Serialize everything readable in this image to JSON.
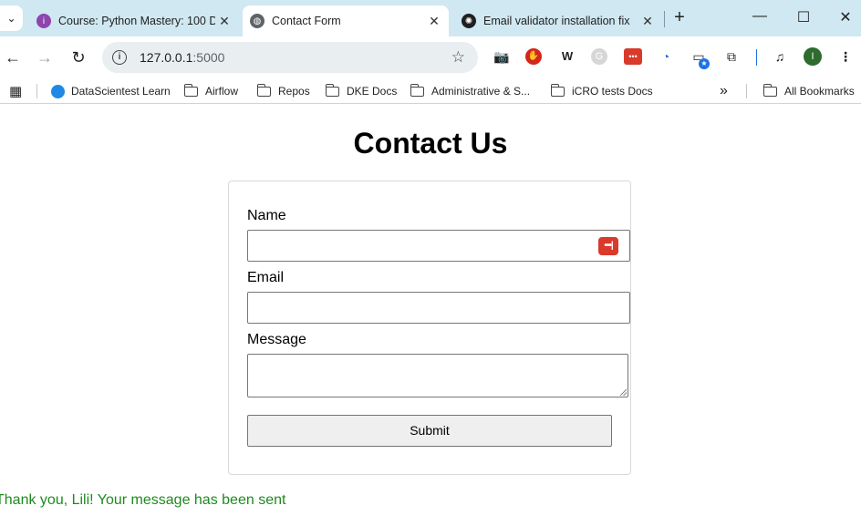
{
  "browser": {
    "tabs": [
      {
        "title": "Course: Python Mastery: 100 D",
        "favicon": "course-icon",
        "favicon_color": "#8e44ad"
      },
      {
        "title": "Contact Form",
        "favicon": "globe-icon",
        "favicon_color": "#5f6368"
      },
      {
        "title": "Email validator installation fix",
        "favicon": "chatgpt-icon",
        "favicon_color": "#1f1f1f"
      }
    ],
    "url_host": "127.0.0.1",
    "url_port": ":5000",
    "profile_initial": "I",
    "bookmarks": [
      {
        "label": "DataScientest Learn",
        "type": "site"
      },
      {
        "label": "Airflow",
        "type": "folder"
      },
      {
        "label": "Repos",
        "type": "folder"
      },
      {
        "label": "DKE Docs",
        "type": "folder"
      },
      {
        "label": "Administrative & S...",
        "type": "folder"
      },
      {
        "label": "iCRO tests Docs",
        "type": "folder"
      }
    ],
    "all_bookmarks_label": "All Bookmarks",
    "more_bookmarks": "»"
  },
  "page": {
    "heading": "Contact Us",
    "form": {
      "name_label": "Name",
      "email_label": "Email",
      "message_label": "Message",
      "submit_label": "Submit"
    },
    "success_message": "Thank you, Lili! Your message has been sent"
  },
  "colors": {
    "tabstrip": "#cfe8f1",
    "success": "#1f8a1f",
    "profile": "#2e6b2e"
  }
}
